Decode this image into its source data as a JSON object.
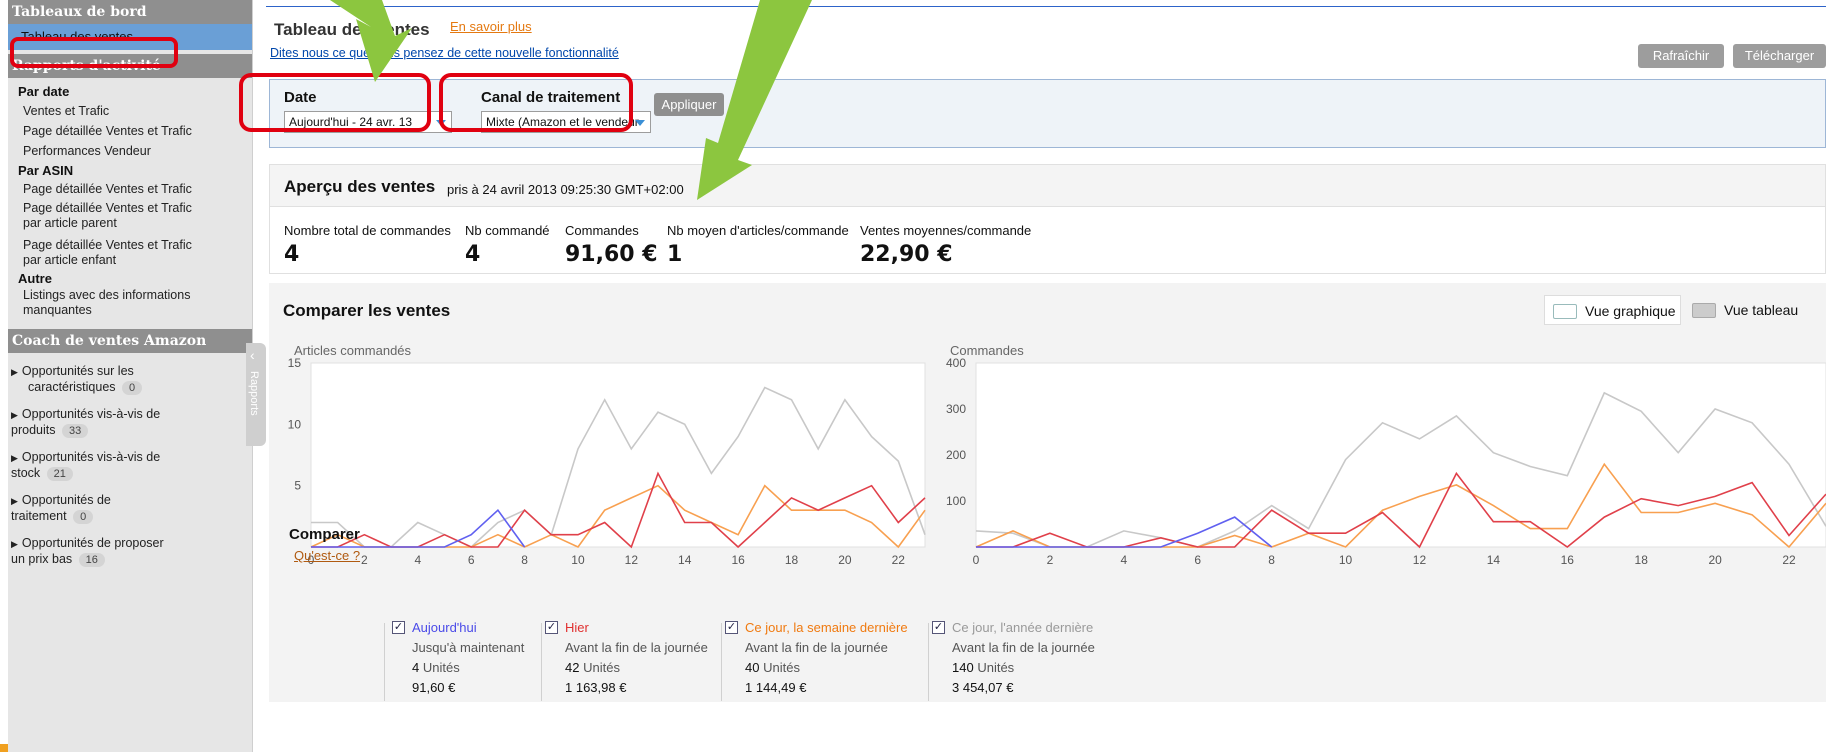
{
  "sidebar": {
    "header_dashboards": "Tableaux de bord",
    "active_item": "Tableau des ventes",
    "header_reports": "Rapports d'activité",
    "section_by_date": "Par date",
    "by_date_items": [
      "Ventes et Trafic",
      "Page détaillée Ventes et Trafic",
      "Performances Vendeur"
    ],
    "section_by_asin": "Par ASIN",
    "by_asin_item_1": "Page détaillée Ventes et Trafic",
    "by_asin_item_2a": "Page détaillée Ventes et Trafic",
    "by_asin_item_2b": "par article parent",
    "by_asin_item_3a": "Page détaillée Ventes et Trafic",
    "by_asin_item_3b": "par article enfant",
    "section_other": "Autre",
    "other_item_a": "Listings avec des informations",
    "other_item_b": "manquantes",
    "header_coach": "Coach de ventes Amazon",
    "coach": [
      {
        "line1": "Opportunités sur les",
        "line2": "caractéristiques",
        "count": "0"
      },
      {
        "line1": "Opportunités vis-à-vis de",
        "line2": "produits",
        "count": "33"
      },
      {
        "line1": "Opportunités vis-à-vis de",
        "line2": "stock",
        "count": "21"
      },
      {
        "line1": "Opportunités de",
        "line2": "traitement",
        "count": "0"
      },
      {
        "line1": "Opportunités de proposer",
        "line2": "un prix bas",
        "count": "16"
      }
    ],
    "collapse_label": "Rapports"
  },
  "header": {
    "title": "Tableau des ventes",
    "learn_more": "En savoir plus",
    "feedback": "Dites nous ce que vous pensez de cette nouvelle fonctionnalité",
    "refresh": "Rafraîchir",
    "download": "Télécharger"
  },
  "filters": {
    "date_label": "Date",
    "date_value": "Aujourd'hui - 24 avr. 13",
    "channel_label": "Canal de traitement",
    "channel_value": "Mixte (Amazon et le vendeur",
    "apply": "Appliquer"
  },
  "overview": {
    "title": "Aperçu des ventes",
    "timestamp": "pris à 24 avril 2013 09:25:30 GMT+02:00",
    "metrics": [
      {
        "label": "Nombre total de commandes",
        "value": "4"
      },
      {
        "label": "Nb commandé",
        "value": "4"
      },
      {
        "label": "Commandes",
        "value": "91,60 €"
      },
      {
        "label": "Nb moyen d'articles/commande",
        "value": "1"
      },
      {
        "label": "Ventes moyennes/commande",
        "value": "22,90 €"
      }
    ]
  },
  "compare": {
    "title": "Comparer les ventes",
    "graph_view": "Vue graphique",
    "table_view": "Vue tableau",
    "compare_label": "Comparer",
    "whats_this": "Qu'est-ce ?",
    "check_mark": "✓",
    "units_word": "Unités",
    "columns": [
      {
        "name": "Aujourd'hui",
        "sub": "Jusqu'à maintenant",
        "units": "4",
        "amount": "91,60 €",
        "color": "#5a5af0"
      },
      {
        "name": "Hier",
        "sub": "Avant la fin de la journée",
        "units": "42",
        "amount": "1 163,98 €",
        "color": "#e03030"
      },
      {
        "name": "Ce jour, la semaine dernière",
        "sub": "Avant la fin de la journée",
        "units": "40",
        "amount": "1 144,49 €",
        "color": "#f07a10"
      },
      {
        "name": "Ce jour, l'année dernière",
        "sub": "Avant la fin de la journée",
        "units": "140",
        "amount": "3 454,07 €",
        "color": "#999999"
      }
    ]
  },
  "colors": {
    "today": "#6060f0",
    "yesterday": "#e0404a",
    "last_week": "#f8a050",
    "last_year": "#c8c8c8",
    "annotation_red": "#e00010",
    "arrow_green": "#8cc63f"
  },
  "chart_data": [
    {
      "type": "line",
      "title": "Articles commandés",
      "x": [
        0,
        1,
        2,
        3,
        4,
        5,
        6,
        7,
        8,
        9,
        10,
        11,
        12,
        13,
        14,
        15,
        16,
        17,
        18,
        19,
        20,
        21,
        22,
        23
      ],
      "xticks": [
        0,
        2,
        4,
        6,
        8,
        10,
        12,
        14,
        16,
        18,
        20,
        22
      ],
      "ylim": [
        0,
        15
      ],
      "yticks": [
        5,
        10,
        15
      ],
      "series": [
        {
          "name": "Aujourd'hui",
          "values": [
            0,
            0,
            0,
            0,
            0,
            0,
            1,
            3,
            0,
            null,
            null,
            null,
            null,
            null,
            null,
            null,
            null,
            null,
            null,
            null,
            null,
            null,
            null,
            null
          ]
        },
        {
          "name": "Hier",
          "values": [
            0,
            0,
            1,
            0,
            0,
            1,
            0,
            0,
            3,
            1,
            1,
            2,
            0,
            6,
            2,
            2,
            0,
            2,
            4,
            3,
            4,
            5,
            2,
            4
          ]
        },
        {
          "name": "Ce jour, la semaine dernière",
          "values": [
            0,
            1,
            0,
            0,
            0,
            0,
            0,
            1,
            0,
            1,
            0,
            3,
            4,
            5,
            3,
            2,
            1,
            5,
            3,
            3,
            3,
            2,
            0,
            3
          ]
        },
        {
          "name": "Ce jour, l'année dernière",
          "values": [
            2,
            2,
            0,
            0,
            2,
            1,
            0,
            2,
            3,
            1,
            8,
            12,
            8,
            11,
            10,
            6,
            9,
            13,
            12,
            8,
            12,
            9,
            7,
            1
          ]
        }
      ]
    },
    {
      "type": "line",
      "title": "Commandes",
      "x": [
        0,
        1,
        2,
        3,
        4,
        5,
        6,
        7,
        8,
        9,
        10,
        11,
        12,
        13,
        14,
        15,
        16,
        17,
        18,
        19,
        20,
        21,
        22,
        23
      ],
      "xticks": [
        0,
        2,
        4,
        6,
        8,
        10,
        12,
        14,
        16,
        18,
        20,
        22
      ],
      "ylim": [
        0,
        400
      ],
      "yticks": [
        100,
        200,
        300,
        400
      ],
      "series": [
        {
          "name": "Aujourd'hui",
          "values": [
            0,
            0,
            0,
            0,
            0,
            0,
            30,
            65,
            0,
            null,
            null,
            null,
            null,
            null,
            null,
            null,
            null,
            null,
            null,
            null,
            null,
            null,
            null,
            null
          ]
        },
        {
          "name": "Hier",
          "values": [
            0,
            0,
            30,
            0,
            0,
            20,
            0,
            0,
            80,
            30,
            30,
            75,
            0,
            160,
            55,
            55,
            0,
            65,
            105,
            90,
            110,
            140,
            25,
            115
          ]
        },
        {
          "name": "Ce jour, la semaine dernière",
          "values": [
            0,
            35,
            0,
            0,
            0,
            0,
            0,
            25,
            0,
            30,
            0,
            80,
            110,
            135,
            90,
            40,
            40,
            180,
            75,
            75,
            95,
            70,
            0,
            95
          ]
        },
        {
          "name": "Ce jour, l'année dernière",
          "values": [
            35,
            30,
            0,
            0,
            35,
            20,
            0,
            35,
            90,
            40,
            190,
            270,
            235,
            285,
            205,
            175,
            155,
            335,
            295,
            205,
            300,
            270,
            180,
            45
          ]
        }
      ]
    }
  ]
}
